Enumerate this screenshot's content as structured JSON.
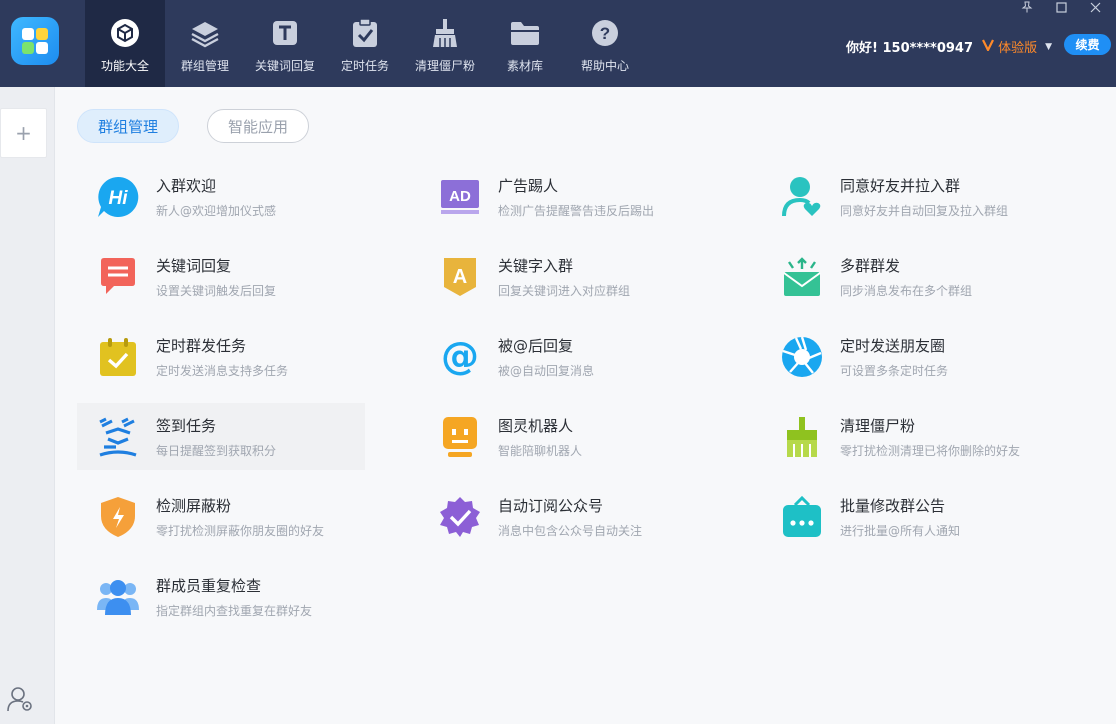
{
  "header": {
    "nav": [
      {
        "label": "功能大全",
        "icon": "cube-icon",
        "active": true
      },
      {
        "label": "群组管理",
        "icon": "layers-icon",
        "active": false
      },
      {
        "label": "关键词回复",
        "icon": "keyword-t-icon",
        "active": false
      },
      {
        "label": "定时任务",
        "icon": "clipboard-check-icon",
        "active": false
      },
      {
        "label": "清理僵尸粉",
        "icon": "broom-icon",
        "active": false
      },
      {
        "label": "素材库",
        "icon": "folder-icon",
        "active": false
      },
      {
        "label": "帮助中心",
        "icon": "help-icon",
        "active": false
      }
    ],
    "greeting": "你好! 150****0947",
    "plan": "体验版",
    "renew_label": "续费"
  },
  "sidebar": {
    "add_label": "+"
  },
  "tabs": [
    {
      "label": "群组管理",
      "active": true
    },
    {
      "label": "智能应用",
      "active": false
    }
  ],
  "features": [
    {
      "title": "入群欢迎",
      "desc": "新人@欢迎增加仪式感",
      "icon": "hi-bubble-icon"
    },
    {
      "title": "广告踢人",
      "desc": "检测广告提醒警告违反后踢出",
      "icon": "ad-icon"
    },
    {
      "title": "同意好友并拉入群",
      "desc": "同意好友并自动回复及拉入群组",
      "icon": "user-heart-icon"
    },
    {
      "title": "关键词回复",
      "desc": "设置关键词触发后回复",
      "icon": "chat-lines-icon"
    },
    {
      "title": "关键字入群",
      "desc": "回复关键词进入对应群组",
      "icon": "letter-a-badge-icon"
    },
    {
      "title": "多群群发",
      "desc": "同步消息发布在多个群组",
      "icon": "mail-broadcast-icon"
    },
    {
      "title": "定时群发任务",
      "desc": "定时发送消息支持多任务",
      "icon": "calendar-check-icon"
    },
    {
      "title": "被@后回复",
      "desc": "被@自动回复消息",
      "icon": "at-sign-icon"
    },
    {
      "title": "定时发送朋友圈",
      "desc": "可设置多条定时任务",
      "icon": "aperture-icon"
    },
    {
      "title": "签到任务",
      "desc": "每日提醒签到获取积分",
      "icon": "sign-in-glyph-icon"
    },
    {
      "title": "图灵机器人",
      "desc": "智能陪聊机器人",
      "icon": "robot-icon"
    },
    {
      "title": "清理僵尸粉",
      "desc": "零打扰检测清理已将你删除的好友",
      "icon": "brush-icon"
    },
    {
      "title": "检测屏蔽粉",
      "desc": "零打扰检测屏蔽你朋友圈的好友",
      "icon": "shield-bolt-icon"
    },
    {
      "title": "自动订阅公众号",
      "desc": "消息中包含公众号自动关注",
      "icon": "verified-badge-icon"
    },
    {
      "title": "批量修改群公告",
      "desc": "进行批量@所有人通知",
      "icon": "notice-bag-icon"
    },
    {
      "title": "群成员重复检查",
      "desc": "指定群组内查找重复在群好友",
      "icon": "group-users-icon"
    }
  ]
}
